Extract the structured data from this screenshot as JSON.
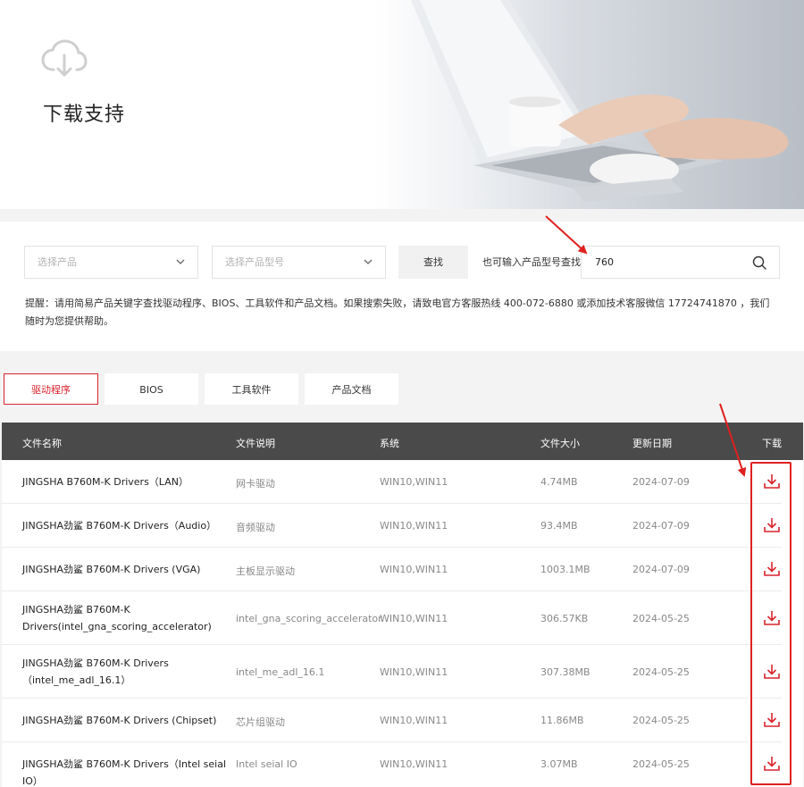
{
  "hero": {
    "title": "下载支持",
    "cloud_icon": "cloud-download-icon"
  },
  "search": {
    "product_placeholder": "选择产品",
    "model_placeholder": "选择产品型号",
    "find_label": "查找",
    "alt_label": "也可输入产品型号查找",
    "model_input_value": "760",
    "search_icon": "search-icon",
    "tip": "提醒：请用简易产品关键字查找驱动程序、BIOS、工具软件和产品文档。如果搜索失败，请致电官方客服热线 400-072-6880 或添加技术客服微信 17724741870 ，我们随时为您提供帮助。"
  },
  "tabs": [
    {
      "label": "驱动程序",
      "active": true
    },
    {
      "label": "BIOS",
      "active": false
    },
    {
      "label": "工具软件",
      "active": false
    },
    {
      "label": "产品文档",
      "active": false
    }
  ],
  "table": {
    "headers": {
      "name": "文件名称",
      "desc": "文件说明",
      "os": "系统",
      "size": "文件大小",
      "date": "更新日期",
      "download": "下载"
    },
    "rows": [
      {
        "name": "JINGSHA B760M-K Drivers（LAN）",
        "desc": "网卡驱动",
        "os": "WIN10,WIN11",
        "size": "4.74MB",
        "date": "2024-07-09"
      },
      {
        "name": "JINGSHA劲鲨 B760M-K Drivers（Audio）",
        "desc": "音频驱动",
        "os": "WIN10,WIN11",
        "size": "93.4MB",
        "date": "2024-07-09"
      },
      {
        "name": "JINGSHA劲鲨 B760M-K Drivers (VGA)",
        "desc": "主板显示驱动",
        "os": "WIN10,WIN11",
        "size": "1003.1MB",
        "date": "2024-07-09"
      },
      {
        "name": "JINGSHA劲鲨 B760M-K Drivers(intel_gna_scoring_accelerator)",
        "desc": "intel_gna_scoring_accelerator",
        "os": "WIN10,WIN11",
        "size": "306.57KB",
        "date": "2024-05-25"
      },
      {
        "name": "JINGSHA劲鲨 B760M-K Drivers（intel_me_adl_16.1）",
        "desc": "intel_me_adl_16.1",
        "os": "WIN10,WIN11",
        "size": "307.38MB",
        "date": "2024-05-25"
      },
      {
        "name": "JINGSHA劲鲨 B760M-K Drivers (Chipset)",
        "desc": "芯片组驱动",
        "os": "WIN10,WIN11",
        "size": "11.86MB",
        "date": "2024-05-25"
      },
      {
        "name": "JINGSHA劲鲨 B760M-K Drivers（Intel seial IO）",
        "desc": "Intel seial IO",
        "os": "WIN10,WIN11",
        "size": "3.07MB",
        "date": "2024-05-25"
      }
    ]
  },
  "colors": {
    "accent": "#d9232d",
    "header_bg": "#4a4a4a",
    "annotation": "#e02020"
  }
}
